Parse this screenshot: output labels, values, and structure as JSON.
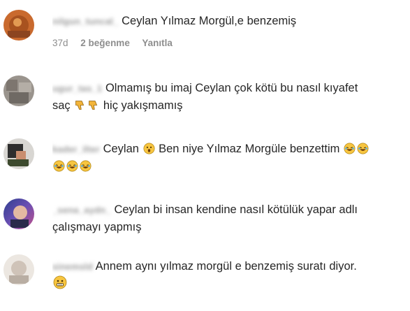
{
  "comments": [
    {
      "username": "nilgun_tuncal_",
      "text": "Ceylan Yılmaz Morgül,e benzemiş",
      "time": "37d",
      "likes": "2 beğenme",
      "reply": "Yanıtla",
      "avatar_color": "#c96a2e"
    },
    {
      "username": "ugur_tas_1",
      "text_line1": "Olmamış bu imaj Ceylan çok kötü bu nasıl kıyafet",
      "text_line2_a": "saç",
      "text_line2_b": "hiç yakışmamış",
      "avatar_color": "#9a948d",
      "emojis": [
        "thumbs-down-icon",
        "thumbs-down-icon"
      ]
    },
    {
      "username": "kader_ilter",
      "text_a": "Ceylan",
      "text_b": "Ben niye Yılmaz Morgüle benzettim",
      "avatar_color": "#3a3a3a",
      "emojis": [
        "astonished-face-icon",
        "laughing-face-icon",
        "laughing-face-icon",
        "laughing-face-icon",
        "laughing-face-icon",
        "laughing-face-icon"
      ]
    },
    {
      "username": "_sena_aydn_",
      "text_line1": "Ceylan bi insan kendine nasıl kötülük yapar adlı",
      "text_line2": "çalışmayı yapmış",
      "avatar_color": "#4a5fb0"
    },
    {
      "username": "sinemsld",
      "text": "Annem aynı yılmaz morgül e benzemiş suratı diyor.",
      "avatar_color": "#cfc3b8",
      "emojis": [
        "grimacing-face-icon"
      ]
    }
  ]
}
